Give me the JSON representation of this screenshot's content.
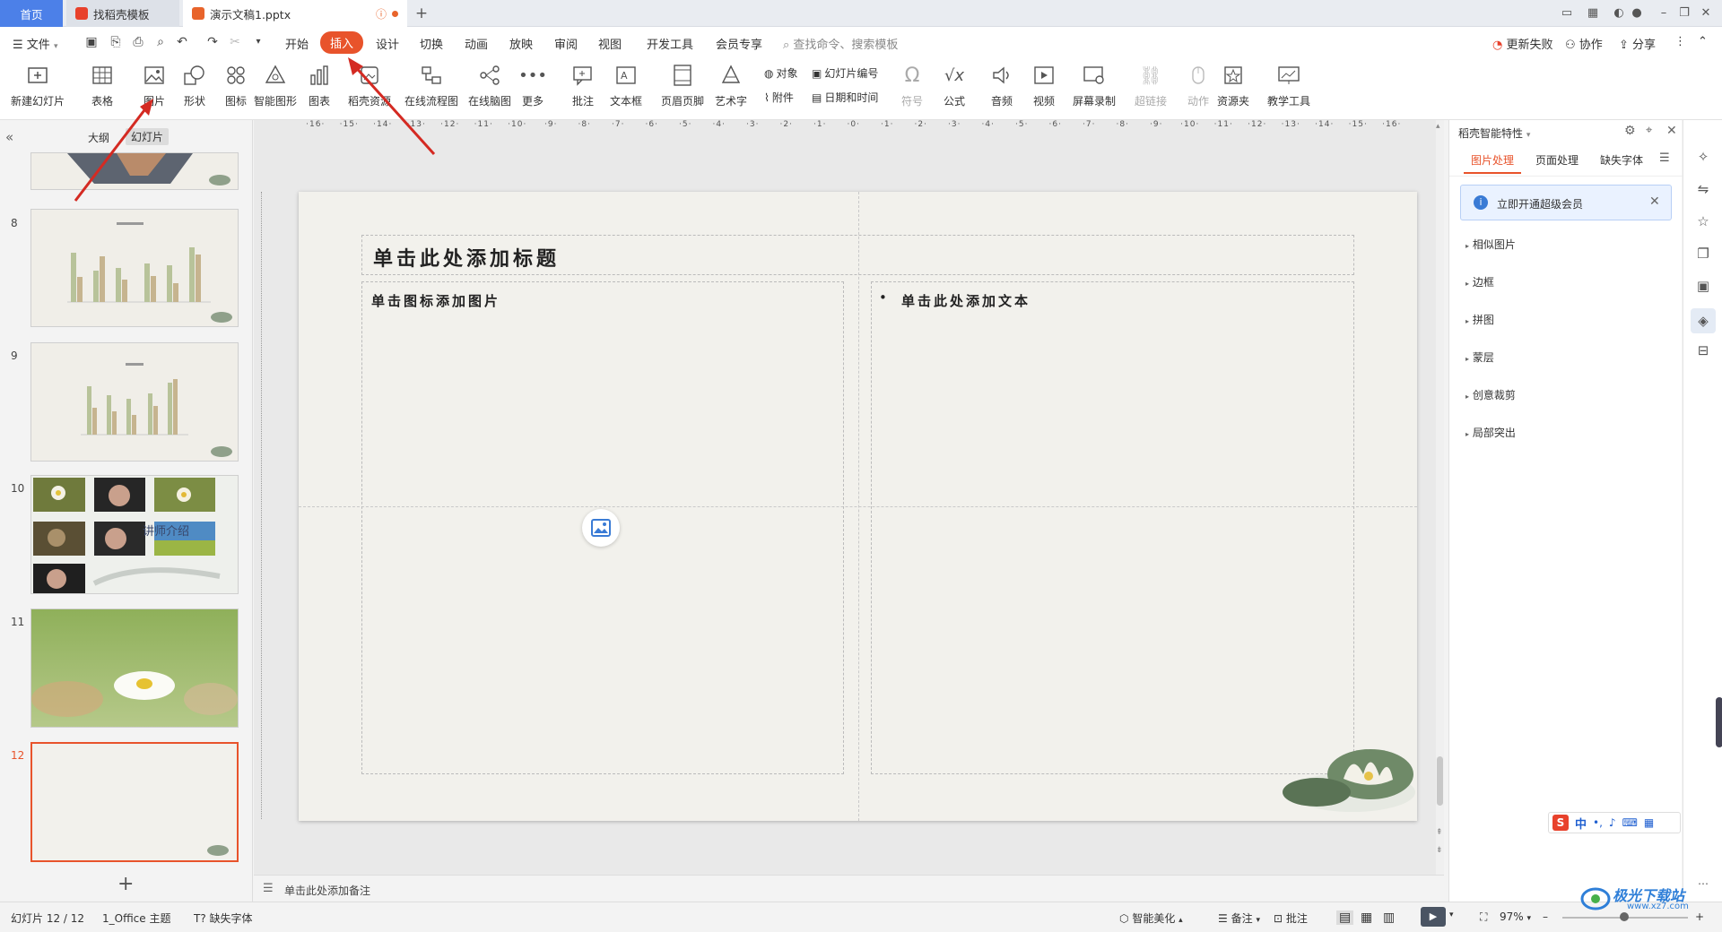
{
  "tabs": {
    "home": "首页",
    "template": "找稻壳模板",
    "document": "演示文稿1.pptx"
  },
  "menu": {
    "file": "文件",
    "items": [
      "开始",
      "插入",
      "设计",
      "切换",
      "动画",
      "放映",
      "审阅",
      "视图",
      "开发工具",
      "会员专享"
    ],
    "search_placeholder": "查找命令、搜索模板",
    "update_failed": "更新失败",
    "collaborate": "协作",
    "share": "分享"
  },
  "ribbon": {
    "new_slide": "新建幻灯片",
    "table": "表格",
    "picture": "图片",
    "shape": "形状",
    "icon": "图标",
    "smart_art": "智能图形",
    "chart": "图表",
    "docer_resource": "稻壳资源",
    "online_flowchart": "在线流程图",
    "online_mindmap": "在线脑图",
    "more": "更多",
    "comment": "批注",
    "textbox": "文本框",
    "header_footer": "页眉页脚",
    "wordart": "艺术字",
    "object": "对象",
    "slide_number": "幻灯片编号",
    "attachment": "附件",
    "datetime": "日期和时间",
    "symbol": "符号",
    "formula": "公式",
    "audio": "音频",
    "video": "视频",
    "screen_record": "屏幕录制",
    "hyperlink": "超链接",
    "action": "动作",
    "resource_folder": "资源夹",
    "teaching_tools": "教学工具"
  },
  "left_panel": {
    "tab_outline": "大纲",
    "tab_slides": "幻灯片",
    "slide_numbers": [
      "8",
      "9",
      "10",
      "11",
      "12"
    ],
    "thumb10_caption": "讲师介绍"
  },
  "ruler": {
    "h_labels": [
      "16",
      "15",
      "14",
      "13",
      "12",
      "11",
      "10",
      "9",
      "8",
      "7",
      "6",
      "5",
      "4",
      "3",
      "2",
      "1",
      "0",
      "1",
      "2",
      "3",
      "4",
      "5",
      "6",
      "7",
      "8",
      "9",
      "10",
      "11",
      "12",
      "13",
      "14",
      "15",
      "16"
    ]
  },
  "slide": {
    "title_placeholder": "单击此处添加标题",
    "left_placeholder": "单击图标添加图片",
    "right_placeholder": "单击此处添加文本"
  },
  "notes": {
    "placeholder": "单击此处添加备注"
  },
  "right_panel": {
    "header": "稻壳智能特性",
    "tabs": [
      "图片处理",
      "页面处理",
      "缺失字体"
    ],
    "vip_banner": "立即开通超级会员",
    "items": [
      "相似图片",
      "边框",
      "拼图",
      "蒙层",
      "创意裁剪",
      "局部突出"
    ]
  },
  "status": {
    "slide_counter": "幻灯片 12 / 12",
    "theme": "1_Office 主题",
    "missing_font": "缺失字体",
    "smart_beautify": "智能美化",
    "notes": "备注",
    "comment": "批注",
    "zoom": "97%"
  },
  "ime": {
    "lang": "中"
  },
  "watermark": {
    "site_name": "极光下载站",
    "url": "www.xz7.com"
  },
  "colors": {
    "accent": "#e8532b",
    "highlight_tab": "#e8532b",
    "home_tab": "#4c80e8",
    "arrow": "#d42a22"
  }
}
